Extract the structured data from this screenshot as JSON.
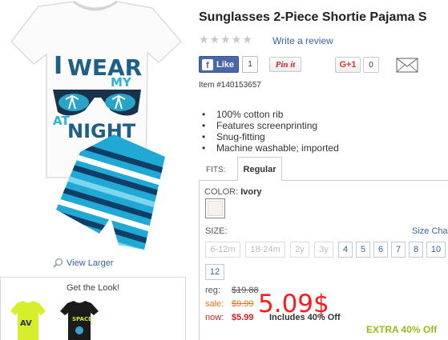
{
  "product": {
    "title": "Sunglasses 2-Piece Shortie Pajama S",
    "write_review": "Write a review",
    "item_number": "Item #140153657",
    "features": [
      "100% cotton rib",
      "Features screenprinting",
      "Snug-fitting",
      "Machine washable; imported"
    ],
    "shirt_graphic": {
      "line1": "I WEAR",
      "line1b": "MY",
      "line2": "AT",
      "line3": "NIGHT"
    }
  },
  "social": {
    "fb_like": "Like",
    "fb_count": "1",
    "pinit": "Pin it",
    "gplus": "G+1",
    "gplus_count": "0"
  },
  "view_larger": "View Larger",
  "get_the_look": "Get the Look!",
  "look_thumb_text": "SPACE",
  "fits": {
    "label": "FITS:",
    "selected_tab": "Regular"
  },
  "color": {
    "label": "COLOR:",
    "value": "Ivory",
    "swatch_color": "#f6f3ee"
  },
  "size": {
    "label": "SIZE:",
    "chart_link": "Size Cha",
    "options": [
      {
        "label": "6-12m",
        "available": false
      },
      {
        "label": "18-24m",
        "available": false
      },
      {
        "label": "2y",
        "available": false
      },
      {
        "label": "3y",
        "available": false
      },
      {
        "label": "4",
        "available": true
      },
      {
        "label": "5",
        "available": true
      },
      {
        "label": "6",
        "available": true
      },
      {
        "label": "7",
        "available": true
      },
      {
        "label": "8",
        "available": true
      },
      {
        "label": "10",
        "available": true
      },
      {
        "label": "12",
        "available": true
      }
    ]
  },
  "price": {
    "reg_label": "reg:",
    "reg_value": "$19.88",
    "sale_label": "sale:",
    "sale_value": "$9.99",
    "now_label": "now:",
    "now_value": "$5.99",
    "includes": "Includes 40% Off",
    "overlay": "5.09$",
    "extra_off": "EXTRA 40% Off"
  },
  "colors": {
    "link": "#3366aa",
    "sale": "#e8731c",
    "now": "#cc2222",
    "overlay": "#ff1a1a",
    "extra": "#9bbb1a",
    "fb": "#4a67a9"
  }
}
